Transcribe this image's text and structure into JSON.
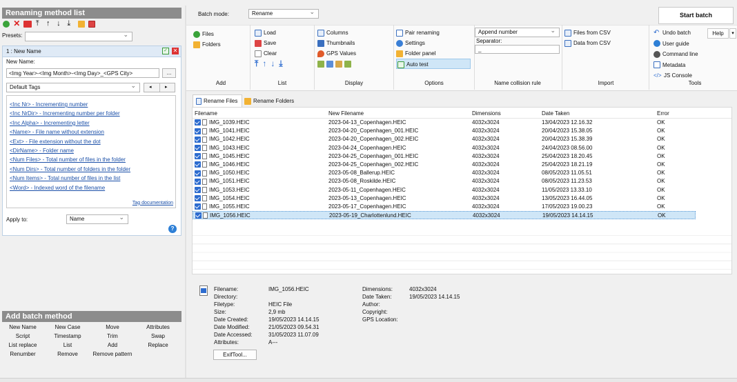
{
  "left": {
    "title": "Renaming method list",
    "presets_label": "Presets:",
    "method_header": "1 : New Name",
    "new_name_label": "New Name:",
    "new_name_value": "<Img Year>-<Img Month>-<Img Day>_<GPS City>",
    "browse_label": "...",
    "tags_select": "Default Tags",
    "tags": [
      "<Inc Nr> - Incrementing number",
      "<Inc NrDir> - Incrementing number per folder",
      "<Inc Alpha> - Incrementing letter",
      "<Name> - File name without extension",
      "<Ext> - File extension without the dot",
      "<DirName> - Folder name",
      "<Num Files> - Total number of files in the folder",
      "<Num Dirs> - Total number of folders in the folder",
      "<Num Items> - Total number of files in the list",
      "<Word> - Indexed word of the filename"
    ],
    "tag_doc": "Tag documentation",
    "apply_to_label": "Apply to:",
    "apply_to_value": "Name",
    "help_mark": "?"
  },
  "batch": {
    "title": "Add batch method",
    "items": [
      [
        "New Name",
        "New Case",
        "Move",
        "Attributes"
      ],
      [
        "Script",
        "Timestamp",
        "Trim",
        "Swap"
      ],
      [
        "List replace",
        "List",
        "Add",
        "Replace"
      ],
      [
        "Renumber",
        "Remove",
        "Remove pattern",
        ""
      ]
    ]
  },
  "top": {
    "batch_mode_label": "Batch mode:",
    "batch_mode_value": "Rename",
    "start": "Start batch",
    "help": "Help"
  },
  "ribbon": {
    "add": {
      "label": "Add",
      "items": [
        "Files",
        "Folders"
      ]
    },
    "list": {
      "label": "List",
      "items": [
        "Load",
        "Save",
        "Clear"
      ]
    },
    "display": {
      "label": "Display",
      "items": [
        "Columns",
        "Thumbnails",
        "GPS Values"
      ]
    },
    "options": {
      "label": "Options",
      "items": [
        "Pair renaming",
        "Settings",
        "Folder panel",
        "Auto test"
      ]
    },
    "collision": {
      "label": "Name collision rule",
      "value": "Append number",
      "separator_label": "Separator:",
      "separator_value": "_"
    },
    "import": {
      "label": "Import",
      "items": [
        "Files from CSV",
        "Data from CSV"
      ]
    },
    "tools": {
      "label": "Tools",
      "items": [
        "Undo batch",
        "User guide",
        "Command line",
        "Metadata",
        "JS Console"
      ]
    }
  },
  "tabs": [
    "Rename Files",
    "Rename Folders"
  ],
  "columns": [
    "Filename",
    "New Filename",
    "Dimensions",
    "Date Taken",
    "Error"
  ],
  "rows": [
    [
      "IMG_1039.HEIC",
      "2023-04-13_Copenhagen.HEIC",
      "4032x3024",
      "13/04/2023 12.16.32",
      "OK"
    ],
    [
      "IMG_1041.HEIC",
      "2023-04-20_Copenhagen_001.HEIC",
      "4032x3024",
      "20/04/2023 15.38.05",
      "OK"
    ],
    [
      "IMG_1042.HEIC",
      "2023-04-20_Copenhagen_002.HEIC",
      "4032x3024",
      "20/04/2023 15.38.39",
      "OK"
    ],
    [
      "IMG_1043.HEIC",
      "2023-04-24_Copenhagen.HEIC",
      "4032x3024",
      "24/04/2023 08.56.00",
      "OK"
    ],
    [
      "IMG_1045.HEIC",
      "2023-04-25_Copenhagen_001.HEIC",
      "4032x3024",
      "25/04/2023 18.20.45",
      "OK"
    ],
    [
      "IMG_1046.HEIC",
      "2023-04-25_Copenhagen_002.HEIC",
      "4032x3024",
      "25/04/2023 18.21.19",
      "OK"
    ],
    [
      "IMG_1050.HEIC",
      "2023-05-08_Ballerup.HEIC",
      "4032x3024",
      "08/05/2023 11.05.51",
      "OK"
    ],
    [
      "IMG_1051.HEIC",
      "2023-05-08_Roskilde.HEIC",
      "4032x3024",
      "08/05/2023 11.23.53",
      "OK"
    ],
    [
      "IMG_1053.HEIC",
      "2023-05-11_Copenhagen.HEIC",
      "4032x3024",
      "11/05/2023 13.33.10",
      "OK"
    ],
    [
      "IMG_1054.HEIC",
      "2023-05-13_Copenhagen.HEIC",
      "4032x3024",
      "13/05/2023 16.44.05",
      "OK"
    ],
    [
      "IMG_1055.HEIC",
      "2023-05-17_Copenhagen.HEIC",
      "4032x3024",
      "17/05/2023 19.00.23",
      "OK"
    ],
    [
      "IMG_1056.HEIC",
      "2023-05-19_Charlottenlund.HEIC",
      "4032x3024",
      "19/05/2023 14.14.15",
      "OK"
    ]
  ],
  "details": {
    "left_labels": [
      "Filename:",
      "Directory:",
      "Filetype:",
      "Size:",
      "Date Created:",
      "Date Modified:",
      "Date Accessed:",
      "Attributes:"
    ],
    "left_values": [
      "IMG_1056.HEIC",
      "",
      "HEIC File",
      "2,9 mb",
      "19/05/2023 14.14.15",
      "21/05/2023 09.54.31",
      "31/05/2023 11.07.09",
      "A---"
    ],
    "right_labels": [
      "Dimensions:",
      "Date Taken:",
      "Author:",
      "Copyright:",
      "GPS Location:"
    ],
    "right_values": [
      "4032x3024",
      "19/05/2023 14.14.15",
      "",
      "",
      ""
    ],
    "exif": "ExifTool..."
  },
  "colors": {
    "accent": "#2d6ccf",
    "selected": "#cfe6f7",
    "link": "#1a4fa8"
  }
}
